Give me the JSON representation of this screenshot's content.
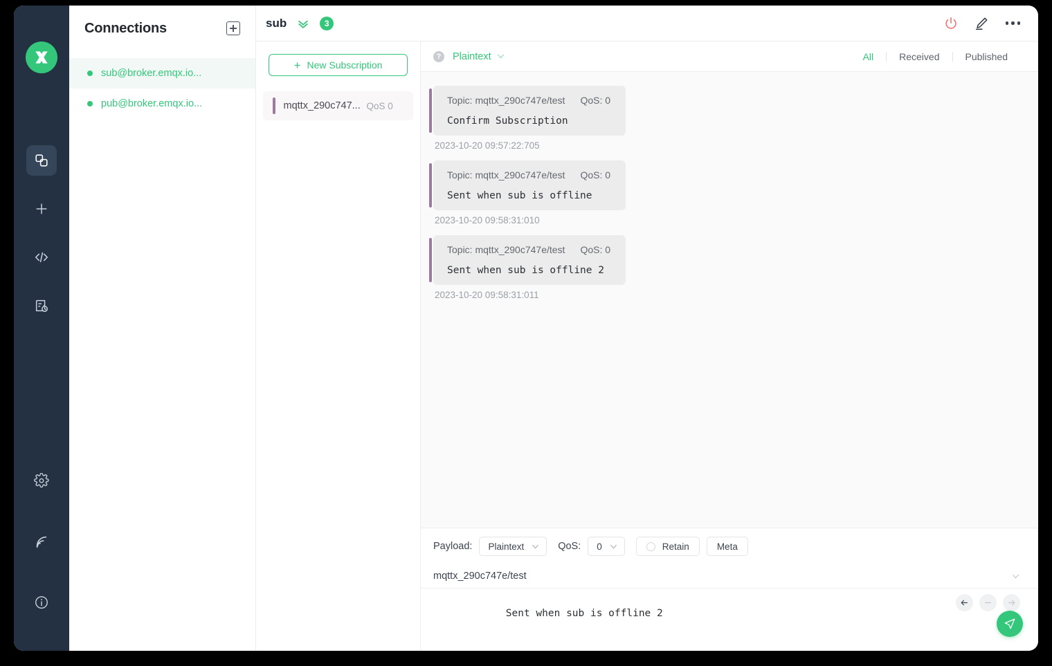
{
  "rail": {
    "logo_icon": "emqx-logo-icon",
    "items": [
      {
        "icon": "connections-icon",
        "name": "connections",
        "active": true
      },
      {
        "icon": "plus-icon",
        "name": "new-connection",
        "active": false
      },
      {
        "icon": "code-icon",
        "name": "scripts",
        "active": false
      },
      {
        "icon": "log-icon",
        "name": "log",
        "active": false
      }
    ],
    "bottom_items": [
      {
        "icon": "gear-icon",
        "name": "settings"
      },
      {
        "icon": "broadcast-icon",
        "name": "broadcast"
      },
      {
        "icon": "info-icon",
        "name": "about"
      }
    ]
  },
  "connections": {
    "title": "Connections",
    "add_icon": "plus-square-icon",
    "items": [
      {
        "label": "sub@broker.emqx.io...",
        "status": "connected",
        "selected": true
      },
      {
        "label": "pub@broker.emqx.io...",
        "status": "connected",
        "selected": false
      }
    ]
  },
  "topbar": {
    "title": "sub",
    "collapse_icon": "double-chevron-down-icon",
    "badge": "3",
    "disconnect_icon": "power-icon",
    "edit_icon": "pencil-icon",
    "more_icon": "ellipsis-icon"
  },
  "subscriptions": {
    "new_button_label": "New Subscription",
    "new_button_icon": "plus-icon",
    "items": [
      {
        "topic": "mqttx_290c747...",
        "qos": "QoS 0",
        "color": "#9b7a9e"
      }
    ]
  },
  "message_toolbar": {
    "help_icon": "question-mark-icon",
    "format": "Plaintext",
    "format_chevron_icon": "chevron-down-icon",
    "filters": [
      {
        "label": "All",
        "active": true
      },
      {
        "label": "Received",
        "active": false
      },
      {
        "label": "Published",
        "active": false
      }
    ]
  },
  "messages": [
    {
      "topic_label": "Topic: mqttx_290c747e/test",
      "qos_label": "QoS: 0",
      "payload": "Confirm Subscription",
      "time": "2023-10-20 09:57:22:705"
    },
    {
      "topic_label": "Topic: mqttx_290c747e/test",
      "qos_label": "QoS: 0",
      "payload": "Sent when sub is offline",
      "time": "2023-10-20 09:58:31:010"
    },
    {
      "topic_label": "Topic: mqttx_290c747e/test",
      "qos_label": "QoS: 0",
      "payload": "Sent when sub is offline 2",
      "time": "2023-10-20 09:58:31:011"
    }
  ],
  "composer": {
    "payload_label": "Payload:",
    "payload_format": "Plaintext",
    "qos_label": "QoS:",
    "qos_value": "0",
    "retain_label": "Retain",
    "retain_checked": false,
    "meta_label": "Meta",
    "topic": "mqttx_290c747e/test",
    "topic_chevron_icon": "chevron-down-icon",
    "message_body": "Sent when sub is offline 2",
    "nav_back_icon": "arrow-left-icon",
    "nav_minus_icon": "minus-icon",
    "nav_forward_icon": "arrow-right-icon",
    "send_icon": "send-icon"
  },
  "colors": {
    "accent": "#34c77b",
    "rail_bg": "#243142",
    "subscription_bar": "#9b7a9e",
    "power_icon": "#f56c6c"
  }
}
